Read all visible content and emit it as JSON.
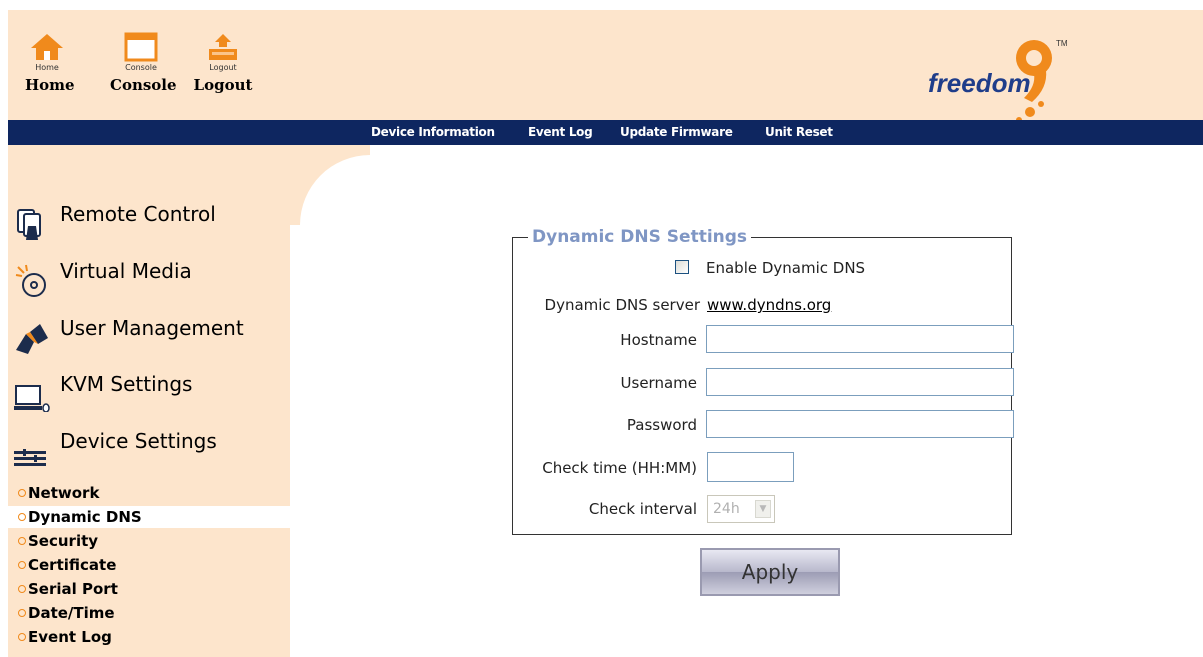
{
  "header": {
    "buttons": [
      {
        "small": "Home",
        "label": "Home"
      },
      {
        "small": "Console",
        "label": "Console"
      },
      {
        "small": "Logout",
        "label": "Logout"
      }
    ],
    "logo": {
      "text": "freedom",
      "mark": "9",
      "tm": "TM"
    }
  },
  "nav": {
    "items": [
      "Device Information",
      "Event Log",
      "Update Firmware",
      "Unit Reset"
    ]
  },
  "sidebar": {
    "main": [
      {
        "label": "Remote Control",
        "icon": "remote-control-icon"
      },
      {
        "label": "Virtual Media",
        "icon": "virtual-media-icon"
      },
      {
        "label": "User Management",
        "icon": "user-management-icon"
      },
      {
        "label": "KVM Settings",
        "icon": "kvm-settings-icon"
      },
      {
        "label": "Device Settings",
        "icon": "device-settings-icon"
      }
    ],
    "sub": [
      "Network",
      "Dynamic DNS",
      "Security",
      "Certificate",
      "Serial Port",
      "Date/Time",
      "Event Log"
    ],
    "active_sub": "Dynamic DNS"
  },
  "form": {
    "legend": "Dynamic DNS Settings",
    "enable_label": "Enable Dynamic DNS",
    "enable_checked": false,
    "server_label": "Dynamic DNS server",
    "server_value": "www.dyndns.org",
    "hostname_label": "Hostname",
    "hostname_value": "",
    "username_label": "Username",
    "username_value": "",
    "password_label": "Password",
    "password_value": "",
    "checktime_label": "Check time (HH:MM)",
    "checktime_value": "",
    "interval_label": "Check interval",
    "interval_value": "24h",
    "apply_label": "Apply"
  },
  "colors": {
    "header_bg": "#fde5cc",
    "navbar_bg": "#0e2660",
    "accent_orange": "#f08a1c",
    "legend_blue": "#7f96c4",
    "logo_blue": "#1f3d8a"
  }
}
